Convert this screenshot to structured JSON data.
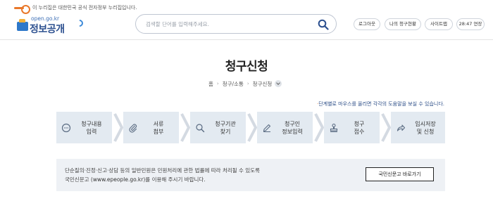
{
  "header": {
    "gov_notice": "이 누리집은 대한민국 공식 전자정부 누리집입니다.",
    "logo_url": "open.go.kr",
    "logo_name": "정보공개",
    "search_placeholder": "검색할 단어를 입력해주세요.",
    "util_buttons": [
      "로그아웃",
      "나의 청구현황",
      "사이트맵",
      "28:47 연장"
    ]
  },
  "page": {
    "title": "청구신청",
    "breadcrumb": [
      "홈",
      "청구/소통",
      "청구신청"
    ],
    "hint_dot": "·",
    "hint": "단계별로 마우스를 올리면 각각의 도움말을 보실 수 있습니다."
  },
  "steps": [
    {
      "label": "청구내용\n입력",
      "icon": "speech-bubble-icon"
    },
    {
      "label": "서류\n첨부",
      "icon": "paperclip-icon"
    },
    {
      "label": "청구기관\n찾기",
      "icon": "magnifier-icon"
    },
    {
      "label": "청구인\n정보입력",
      "icon": "pencil-icon"
    },
    {
      "label": "청구\n접수",
      "icon": "stamp-icon"
    },
    {
      "label": "임시저장\n및 신청",
      "icon": "share-arrow-icon"
    }
  ],
  "info": {
    "line1": "단순질의·진정·신고·상담 등의 일반민원은 민원처리에 관한 법률에 따라 처리될 수 있도록",
    "line2_pre": "국민신문고 (",
    "line2_link": "www.epeople.go.kr",
    "line2_post": ")를 이용해 주시기 바랍니다.",
    "button": "국민신문고 바로가기"
  },
  "colors": {
    "step_bg": "#e3eaf1",
    "info_bg": "#eef1f5",
    "brand_blue": "#2b4f8f",
    "accent_orange": "#e9782a"
  }
}
